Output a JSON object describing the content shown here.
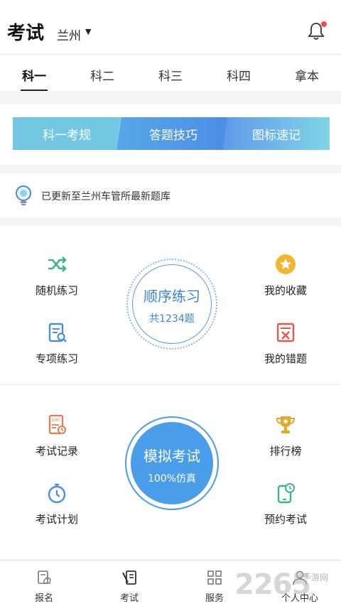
{
  "header": {
    "title": "考试",
    "city": "兰州"
  },
  "tabs": [
    {
      "label": "科一",
      "active": true
    },
    {
      "label": "科二"
    },
    {
      "label": "科三"
    },
    {
      "label": "科四"
    },
    {
      "label": "拿本"
    }
  ],
  "banner": [
    "科一考规",
    "答题技巧",
    "图标速记"
  ],
  "notice": "已更新至兰州车管所最新题库",
  "practice": {
    "random": "随机练习",
    "special": "专项练习",
    "favorites": "我的收藏",
    "mistakes": "我的错题",
    "sequential_title": "顺序练习",
    "sequential_count": "共1234题"
  },
  "exam": {
    "records": "考试记录",
    "plan": "考试计划",
    "ranking": "排行榜",
    "reserve": "预约考试",
    "mock_title": "模拟考试",
    "mock_sub": "100%仿真"
  },
  "bottom_nav": [
    "报名",
    "考试",
    "服务",
    "个人中心"
  ],
  "watermark": {
    "number": "2265",
    "site": "手游网"
  },
  "colors": {
    "accent": "#4a9de8",
    "green": "#3bb58b",
    "red": "#e5584c",
    "gold": "#f2b630",
    "orange": "#e47b4a"
  }
}
